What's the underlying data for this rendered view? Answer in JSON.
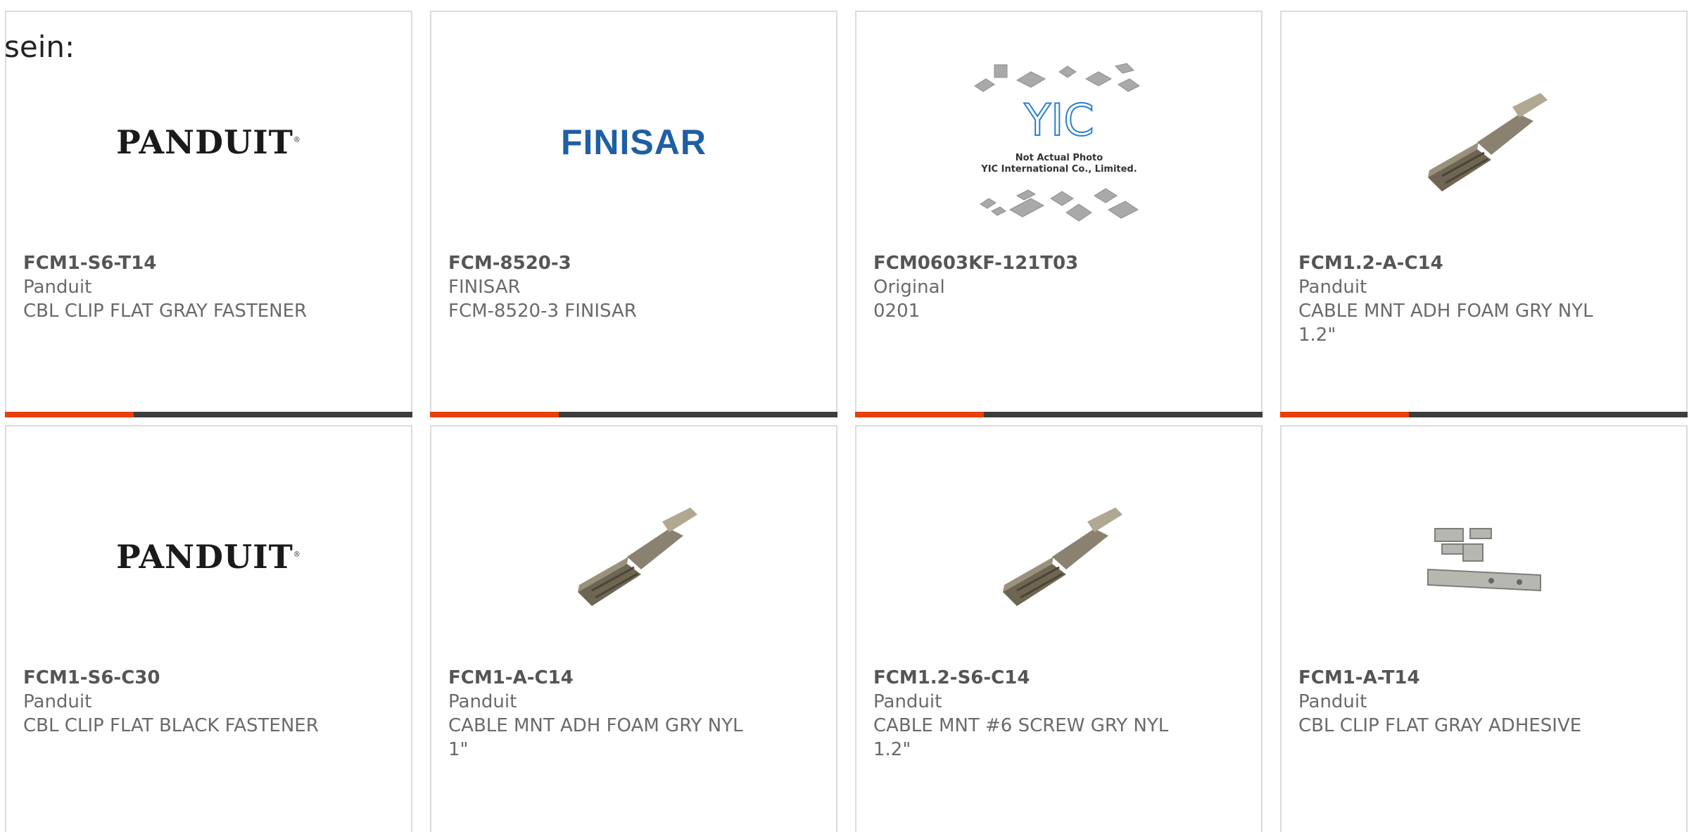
{
  "intro_text": "sein:",
  "products": [
    {
      "part": "FCM1-S6-T14",
      "brand": "Panduit",
      "desc": "CBL CLIP FLAT GRAY FASTENER",
      "image": "panduit-logo",
      "logo_text": "PANDUIT"
    },
    {
      "part": "FCM-8520-3",
      "brand": "FINISAR",
      "desc": "FCM-8520-3 FINISAR",
      "image": "finisar-logo",
      "logo_text": "FINISAR"
    },
    {
      "part": "FCM0603KF-121T03",
      "brand": "Original",
      "desc": "0201",
      "image": "yic-placeholder",
      "logo_text": "YIC",
      "photo_note_1": "Not Actual Photo",
      "photo_note_2": "YIC International Co., Limited."
    },
    {
      "part": "FCM1.2-A-C14",
      "brand": "Panduit",
      "desc": "CABLE MNT ADH FOAM GRY NYL 1.2\"",
      "image": "cable-mount-photo"
    },
    {
      "part": "FCM1-S6-C30",
      "brand": "Panduit",
      "desc": "CBL CLIP FLAT BLACK FASTENER",
      "image": "panduit-logo",
      "logo_text": "PANDUIT"
    },
    {
      "part": "FCM1-A-C14",
      "brand": "Panduit",
      "desc": "CABLE MNT ADH FOAM GRY NYL 1\"",
      "image": "cable-mount-photo"
    },
    {
      "part": "FCM1.2-S6-C14",
      "brand": "Panduit",
      "desc": "CABLE MNT #6 SCREW GRY NYL 1.2\"",
      "image": "cable-mount-photo"
    },
    {
      "part": "FCM1-A-T14",
      "brand": "Panduit",
      "desc": "CBL CLIP FLAT GRAY ADHESIVE",
      "image": "metal-clip-photo"
    }
  ],
  "colors": {
    "accent": "#e8400c",
    "bar": "#3d3d3d",
    "border": "#dcdcdc",
    "text": "#6a6a6a",
    "logo_blue": "#1f5fa3"
  }
}
